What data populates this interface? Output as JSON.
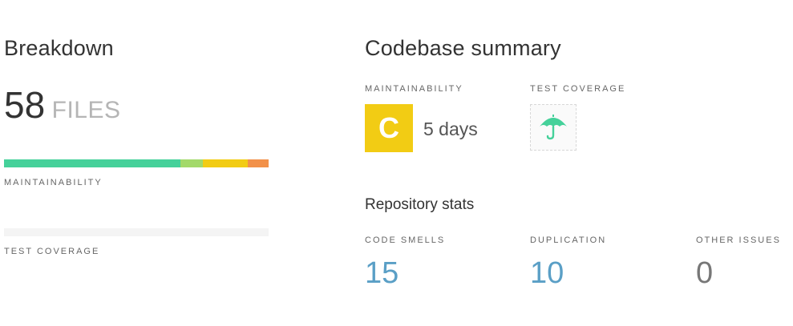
{
  "breakdown": {
    "title": "Breakdown",
    "file_count": "58",
    "file_unit": "FILES",
    "maintainability_label": "MAINTAINABILITY",
    "test_coverage_label": "TEST COVERAGE",
    "maintainability_segments": [
      {
        "grade": "A",
        "color": "#45d19a",
        "fraction": 0.667
      },
      {
        "grade": "B",
        "color": "#a3d96a",
        "fraction": 0.085
      },
      {
        "grade": "C",
        "color": "#f2cc14",
        "fraction": 0.17
      },
      {
        "grade": "D",
        "color": "#f2914a",
        "fraction": 0.078
      }
    ]
  },
  "summary": {
    "title": "Codebase summary",
    "maintainability_label": "MAINTAINABILITY",
    "test_coverage_label": "TEST COVERAGE",
    "grade": "C",
    "grade_color": "#f2cc14",
    "remediation": "5 days",
    "coverage_icon": "umbrella-icon"
  },
  "repo_stats": {
    "title": "Repository stats",
    "stats": [
      {
        "label": "CODE SMELLS",
        "value": "15",
        "color": "#5a9fc6"
      },
      {
        "label": "DUPLICATION",
        "value": "10",
        "color": "#5a9fc6"
      },
      {
        "label": "OTHER ISSUES",
        "value": "0",
        "color": "#777777"
      }
    ]
  }
}
